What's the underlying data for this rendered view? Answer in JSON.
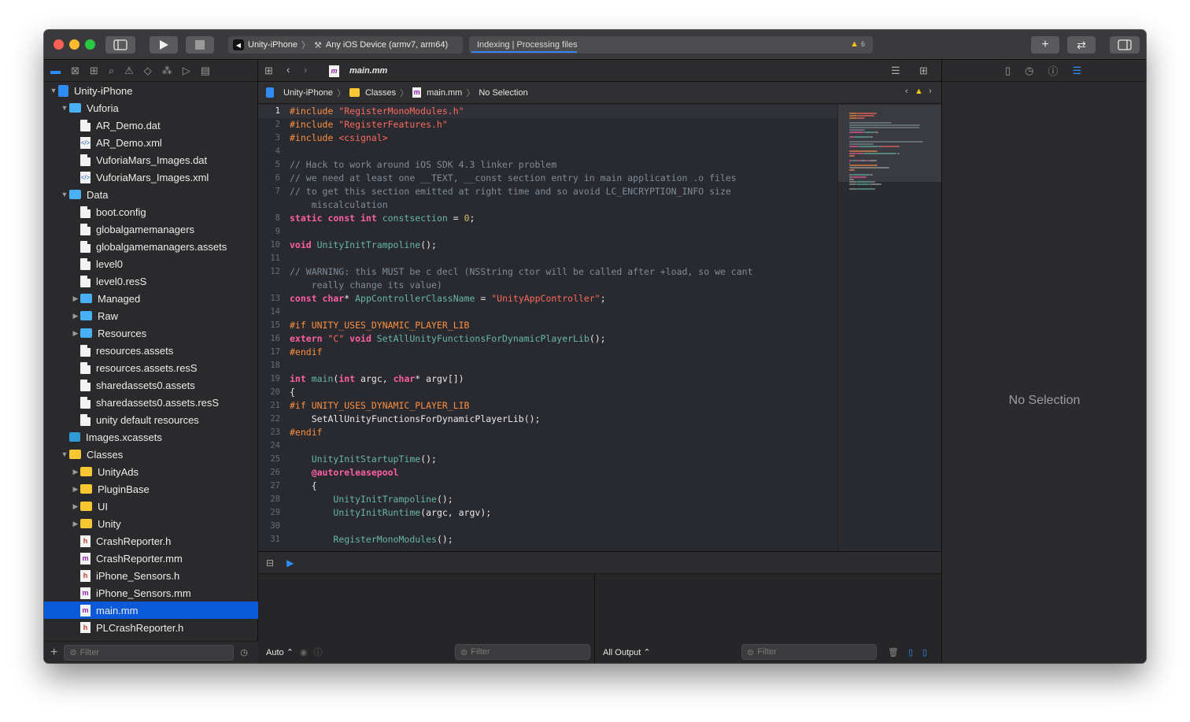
{
  "toolbar": {
    "scheme_name": "Unity-iPhone",
    "destination": "Any iOS Device (armv7, arm64)",
    "activity_text": "Indexing | Processing files",
    "warning_count": "6"
  },
  "navigator": {
    "filter_placeholder": "Filter",
    "tree": [
      {
        "label": "Unity-iPhone",
        "depth": 0,
        "icon": "project",
        "expanded": true
      },
      {
        "label": "Vuforia",
        "depth": 1,
        "icon": "folder-blue",
        "expanded": true
      },
      {
        "label": "AR_Demo.dat",
        "depth": 2,
        "icon": "doc"
      },
      {
        "label": "AR_Demo.xml",
        "depth": 2,
        "icon": "xml"
      },
      {
        "label": "VuforiaMars_Images.dat",
        "depth": 2,
        "icon": "doc"
      },
      {
        "label": "VuforiaMars_Images.xml",
        "depth": 2,
        "icon": "xml"
      },
      {
        "label": "Data",
        "depth": 1,
        "icon": "folder-blue",
        "expanded": true
      },
      {
        "label": "boot.config",
        "depth": 2,
        "icon": "doc"
      },
      {
        "label": "globalgamemanagers",
        "depth": 2,
        "icon": "doc"
      },
      {
        "label": "globalgamemanagers.assets",
        "depth": 2,
        "icon": "doc"
      },
      {
        "label": "level0",
        "depth": 2,
        "icon": "doc"
      },
      {
        "label": "level0.resS",
        "depth": 2,
        "icon": "doc"
      },
      {
        "label": "Managed",
        "depth": 2,
        "icon": "folder-blue",
        "expanded": false
      },
      {
        "label": "Raw",
        "depth": 2,
        "icon": "folder-blue",
        "expanded": false
      },
      {
        "label": "Resources",
        "depth": 2,
        "icon": "folder-blue",
        "expanded": false
      },
      {
        "label": "resources.assets",
        "depth": 2,
        "icon": "doc"
      },
      {
        "label": "resources.assets.resS",
        "depth": 2,
        "icon": "doc"
      },
      {
        "label": "sharedassets0.assets",
        "depth": 2,
        "icon": "doc"
      },
      {
        "label": "sharedassets0.assets.resS",
        "depth": 2,
        "icon": "doc"
      },
      {
        "label": "unity default resources",
        "depth": 2,
        "icon": "doc"
      },
      {
        "label": "Images.xcassets",
        "depth": 1,
        "icon": "assets"
      },
      {
        "label": "Classes",
        "depth": 1,
        "icon": "folder-yellow",
        "expanded": true
      },
      {
        "label": "UnityAds",
        "depth": 2,
        "icon": "folder-yellow",
        "expanded": false
      },
      {
        "label": "PluginBase",
        "depth": 2,
        "icon": "folder-yellow",
        "expanded": false
      },
      {
        "label": "UI",
        "depth": 2,
        "icon": "folder-yellow",
        "expanded": false
      },
      {
        "label": "Unity",
        "depth": 2,
        "icon": "folder-yellow",
        "expanded": false
      },
      {
        "label": "CrashReporter.h",
        "depth": 2,
        "icon": "h"
      },
      {
        "label": "CrashReporter.mm",
        "depth": 2,
        "icon": "m"
      },
      {
        "label": "iPhone_Sensors.h",
        "depth": 2,
        "icon": "h"
      },
      {
        "label": "iPhone_Sensors.mm",
        "depth": 2,
        "icon": "m"
      },
      {
        "label": "main.mm",
        "depth": 2,
        "icon": "m",
        "selected": true
      },
      {
        "label": "PLCrashReporter.h",
        "depth": 2,
        "icon": "h"
      }
    ]
  },
  "editor": {
    "tab_label": "main.mm",
    "jumpbar": [
      "Unity-iPhone",
      "Classes",
      "main.mm",
      "No Selection"
    ],
    "code": [
      {
        "n": "1",
        "tokens": [
          [
            "pp",
            "#include "
          ],
          [
            "str",
            "\"RegisterMonoModules.h\""
          ]
        ],
        "current": true
      },
      {
        "n": "2",
        "tokens": [
          [
            "pp",
            "#include "
          ],
          [
            "str",
            "\"RegisterFeatures.h\""
          ]
        ]
      },
      {
        "n": "3",
        "tokens": [
          [
            "pp",
            "#include "
          ],
          [
            "str",
            "<csignal>"
          ]
        ]
      },
      {
        "n": "4",
        "tokens": []
      },
      {
        "n": "5",
        "tokens": [
          [
            "cm",
            "// Hack to work around iOS SDK 4.3 linker problem"
          ]
        ]
      },
      {
        "n": "6",
        "tokens": [
          [
            "cm",
            "// we need at least one __TEXT, __const section entry in main application .o files"
          ]
        ]
      },
      {
        "n": "7",
        "tokens": [
          [
            "cm",
            "// to get this section emitted at right time and so avoid LC_ENCRYPTION_INFO size"
          ]
        ]
      },
      {
        "n": "",
        "tokens": [
          [
            "cm",
            "    miscalculation"
          ]
        ]
      },
      {
        "n": "8",
        "tokens": [
          [
            "kw",
            "static const int "
          ],
          [
            "fn",
            "constsection"
          ],
          [
            "pl",
            " = "
          ],
          [
            "num",
            "0"
          ],
          [
            "pl",
            ";"
          ]
        ]
      },
      {
        "n": "9",
        "tokens": []
      },
      {
        "n": "10",
        "tokens": [
          [
            "kw",
            "void "
          ],
          [
            "fn",
            "UnityInitTrampoline"
          ],
          [
            "pl",
            "();"
          ]
        ]
      },
      {
        "n": "11",
        "tokens": []
      },
      {
        "n": "12",
        "tokens": [
          [
            "cm",
            "// WARNING: this MUST be c decl (NSString ctor will be called after +load, so we cant"
          ]
        ]
      },
      {
        "n": "",
        "tokens": [
          [
            "cm",
            "    really change its value)"
          ]
        ]
      },
      {
        "n": "13",
        "tokens": [
          [
            "kw",
            "const char"
          ],
          [
            "pl",
            "* "
          ],
          [
            "fn",
            "AppControllerClassName"
          ],
          [
            "pl",
            " = "
          ],
          [
            "str",
            "\"UnityAppController\""
          ],
          [
            "pl",
            ";"
          ]
        ]
      },
      {
        "n": "14",
        "tokens": []
      },
      {
        "n": "15",
        "tokens": [
          [
            "pp",
            "#if UNITY_USES_DYNAMIC_PLAYER_LIB"
          ]
        ]
      },
      {
        "n": "16",
        "tokens": [
          [
            "kw",
            "extern "
          ],
          [
            "str",
            "\"C\""
          ],
          [
            "kw",
            " void "
          ],
          [
            "fn",
            "SetAllUnityFunctionsForDynamicPlayerLib"
          ],
          [
            "pl",
            "();"
          ]
        ]
      },
      {
        "n": "17",
        "tokens": [
          [
            "pp",
            "#endif"
          ]
        ]
      },
      {
        "n": "18",
        "tokens": []
      },
      {
        "n": "19",
        "tokens": [
          [
            "kw",
            "int "
          ],
          [
            "fn",
            "main"
          ],
          [
            "pl",
            "("
          ],
          [
            "kw",
            "int "
          ],
          [
            "pl",
            "argc, "
          ],
          [
            "kw",
            "char"
          ],
          [
            "pl",
            "* argv[])"
          ]
        ]
      },
      {
        "n": "20",
        "tokens": [
          [
            "pl",
            "{"
          ]
        ]
      },
      {
        "n": "21",
        "tokens": [
          [
            "pp",
            "#if UNITY_USES_DYNAMIC_PLAYER_LIB"
          ]
        ]
      },
      {
        "n": "22",
        "tokens": [
          [
            "pl",
            "    SetAllUnityFunctionsForDynamicPlayerLib();"
          ]
        ]
      },
      {
        "n": "23",
        "tokens": [
          [
            "pp",
            "#endif"
          ]
        ]
      },
      {
        "n": "24",
        "tokens": []
      },
      {
        "n": "25",
        "tokens": [
          [
            "pl",
            "    "
          ],
          [
            "fn",
            "UnityInitStartupTime"
          ],
          [
            "pl",
            "();"
          ]
        ]
      },
      {
        "n": "26",
        "tokens": [
          [
            "pl",
            "    "
          ],
          [
            "kw",
            "@autoreleasepool"
          ]
        ]
      },
      {
        "n": "27",
        "tokens": [
          [
            "pl",
            "    {"
          ]
        ]
      },
      {
        "n": "28",
        "tokens": [
          [
            "pl",
            "        "
          ],
          [
            "fn",
            "UnityInitTrampoline"
          ],
          [
            "pl",
            "();"
          ]
        ]
      },
      {
        "n": "29",
        "tokens": [
          [
            "pl",
            "        "
          ],
          [
            "fn",
            "UnityInitRuntime"
          ],
          [
            "pl",
            "(argc, argv);"
          ]
        ]
      },
      {
        "n": "30",
        "tokens": []
      },
      {
        "n": "31",
        "tokens": [
          [
            "pl",
            "        "
          ],
          [
            "fn",
            "RegisterMonoModules"
          ],
          [
            "pl",
            "();"
          ]
        ]
      }
    ]
  },
  "debug": {
    "variables_mode": "Auto",
    "left_filter_placeholder": "Filter",
    "output_mode": "All Output",
    "right_filter_placeholder": "Filter"
  },
  "inspector": {
    "empty_text": "No Selection"
  },
  "colors": {
    "accent": "#2f8cf5",
    "selection": "#0a59d6",
    "warning": "#f5c518"
  }
}
